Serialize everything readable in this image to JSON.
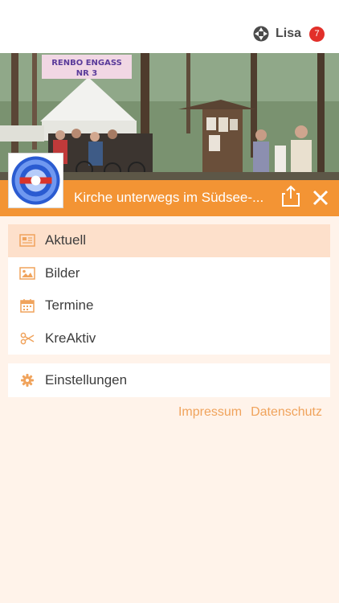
{
  "header": {
    "user_name": "Lisa",
    "notification_count": "7"
  },
  "group": {
    "title": "Kirche unterwegs im Südsee-...",
    "banner_text_1": "RENBO ENGASS",
    "banner_text_2": "NR 3"
  },
  "menu": {
    "items": [
      {
        "label": "Aktuell",
        "icon": "newspaper-icon",
        "active": true
      },
      {
        "label": "Bilder",
        "icon": "image-icon",
        "active": false
      },
      {
        "label": "Termine",
        "icon": "calendar-icon",
        "active": false
      },
      {
        "label": "KreAktiv",
        "icon": "scissors-icon",
        "active": false
      }
    ],
    "settings": {
      "label": "Einstellungen",
      "icon": "gear-icon"
    }
  },
  "footer": {
    "impressum": "Impressum",
    "datenschutz": "Datenschutz"
  },
  "colors": {
    "accent": "#f39434",
    "active_bg": "#fde0cb",
    "page_bg": "#fff3ea",
    "icon": "#f0a35c",
    "badge": "#e2302a"
  }
}
